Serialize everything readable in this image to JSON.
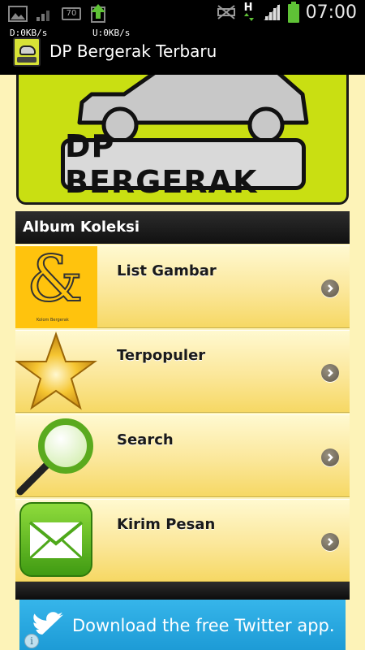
{
  "status_bar": {
    "time": "07:00",
    "battery_level_badge": "70",
    "network_type": "H",
    "icons": [
      "image-notification-icon",
      "signal-weak-icon",
      "battery-notification-icon",
      "upload-icon",
      "mute-icon",
      "data-arrows-icon",
      "signal-strength-icon",
      "battery-charging-icon"
    ]
  },
  "net_speed": {
    "download": "D:0KB/s",
    "upload": "U:0KB/s"
  },
  "app_bar": {
    "title": "DP Bergerak Terbaru",
    "icon": "app-car-icon"
  },
  "banner": {
    "text": "DP BERGERAK",
    "colors": {
      "background": "#c9df12"
    }
  },
  "section": {
    "title": "Album Koleksi"
  },
  "menu": {
    "items": [
      {
        "label": "List Gambar",
        "icon": "ampersand-icon",
        "thumb_caption": "Kolom Bergerak"
      },
      {
        "label": "Terpopuler",
        "icon": "gold-star-icon"
      },
      {
        "label": "Search",
        "icon": "magnifier-icon"
      },
      {
        "label": "Kirim Pesan",
        "icon": "envelope-icon"
      }
    ],
    "arrow_icon": "chevron-right-icon"
  },
  "ad": {
    "text": "Download the free Twitter app.",
    "icon": "twitter-bird-icon",
    "info_icon": "i",
    "colors": {
      "background": "#1d9bd6"
    }
  }
}
